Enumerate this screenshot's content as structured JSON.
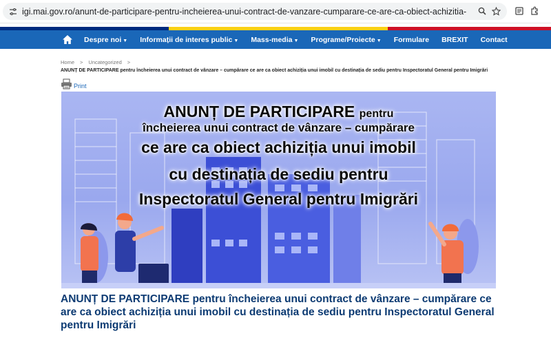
{
  "browser": {
    "url": "igi.mai.gov.ro/anunt-de-participare-pentru-incheierea-unui-contract-de-vanzare-cumparare-ce-are-ca-obiect-achizitia-unui-imobil-cu-destinatia-de-sediu-pentru-inspe..."
  },
  "colors": {
    "nav_bg": "#1a67b8",
    "flag_blue": "#002b7f",
    "flag_yellow": "#fcd116",
    "flag_red": "#ce1126",
    "title": "#0d3b73"
  },
  "nav": {
    "items": [
      {
        "label": "Despre noi",
        "dropdown": true
      },
      {
        "label": "Informații de interes public",
        "dropdown": true
      },
      {
        "label": "Mass-media",
        "dropdown": true
      },
      {
        "label": "Programe/Proiecte",
        "dropdown": true
      },
      {
        "label": "Formulare",
        "dropdown": false
      },
      {
        "label": "BREXIT",
        "dropdown": false
      },
      {
        "label": "Contact",
        "dropdown": false
      }
    ]
  },
  "breadcrumb": {
    "home": "Home",
    "sep": ">",
    "category": "Uncategorized",
    "current": "ANUNȚ DE PARTICIPARE pentru încheierea unui contract de vânzare – cumpărare ce are ca obiect achiziția unui imobil cu destinația de sediu pentru Inspectoratul General pentru Imigrări"
  },
  "print": {
    "label": "Print"
  },
  "banner": {
    "line1_big": "ANUNȚ DE PARTICIPARE",
    "line1_small": "pentru",
    "line2": "încheierea unui contract de vânzare – cumpărare",
    "line3": "ce are ca obiect achiziția unui imobil",
    "line4": "cu destinația de sediu pentru",
    "line5": "Inspectoratul General pentru Imigrări"
  },
  "article": {
    "title": "ANUNȚ DE PARTICIPARE pentru încheierea unui contract de vânzare – cumpărare ce are ca obiect achiziția unui imobil cu destinația de sediu pentru Inspectoratul General pentru Imigrări"
  }
}
